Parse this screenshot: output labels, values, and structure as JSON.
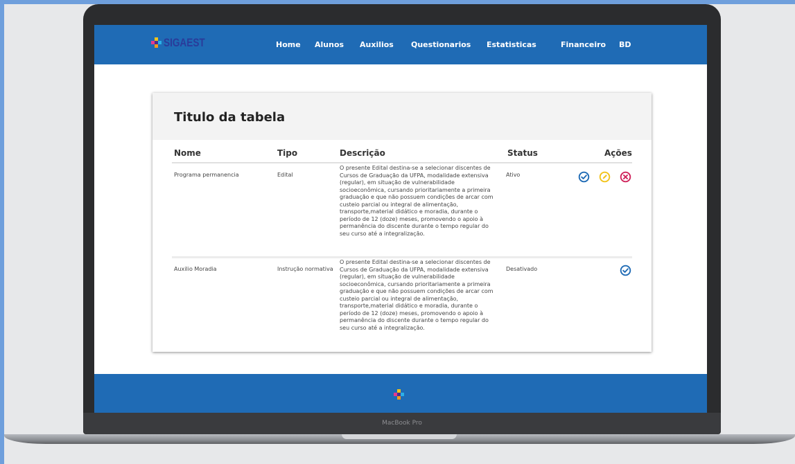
{
  "brand": {
    "name": "SIGAEST"
  },
  "nav": {
    "items": [
      {
        "label": "Home"
      },
      {
        "label": "Alunos"
      },
      {
        "label": "Auxilios"
      },
      {
        "label": "Questionarios"
      },
      {
        "label": "Estatisticas"
      },
      {
        "label": "Financeiro"
      },
      {
        "label": "BD"
      }
    ]
  },
  "table": {
    "title": "Titulo da tabela",
    "columns": [
      "Nome",
      "Tipo",
      "Descrição",
      "Status",
      "Ações"
    ],
    "rows": [
      {
        "nome": "Programa permanencia",
        "tipo": "Edital",
        "descricao_lines": [
          "O presente Edital destina-se a selecionar discentes de",
          "Cursos de Graduação da UFPA, modalidade extensiva",
          "(regular), em situação de vulnerabilidade",
          "socioeconômica, cursando prioritariamente a primeira",
          "graduação e que não possuem condições de arcar com",
          "custeio parcial ou integral de alimentação,",
          "transporte,material didático e moradia, durante o",
          "período de 12 (doze) meses, promovendo o apoio à",
          "permanência do discente durante o tempo regular do",
          "seu curso até a integralização."
        ],
        "status": "Ativo",
        "actions": [
          "check-icon",
          "edit-icon",
          "delete-icon"
        ]
      },
      {
        "nome": "Auxilio Moradia",
        "tipo": "Instrução normativa",
        "descricao_lines": [
          "O presente Edital destina-se a selecionar discentes de",
          "Cursos de Graduação da UFPA, modalidade extensiva",
          "(regular), em situação de vulnerabilidade",
          "socioeconômica, cursando prioritariamente a primeira",
          "graduação e que não possuem condições de arcar com",
          "custeio parcial ou integral de alimentação,",
          "transporte,material didático e moradia, durante o",
          "período de 12 (doze) meses, promovendo o apoio à",
          "permanência do discente durante o tempo regular do",
          "seu curso até a integralização."
        ],
        "status": "Desativado",
        "actions": [
          "check-icon"
        ]
      }
    ]
  },
  "device": {
    "label": "MacBook Pro"
  },
  "colors": {
    "primary": "#1f6bb5",
    "check": "#1f6bb5",
    "edit": "#f2c31b",
    "delete": "#d0245c"
  }
}
